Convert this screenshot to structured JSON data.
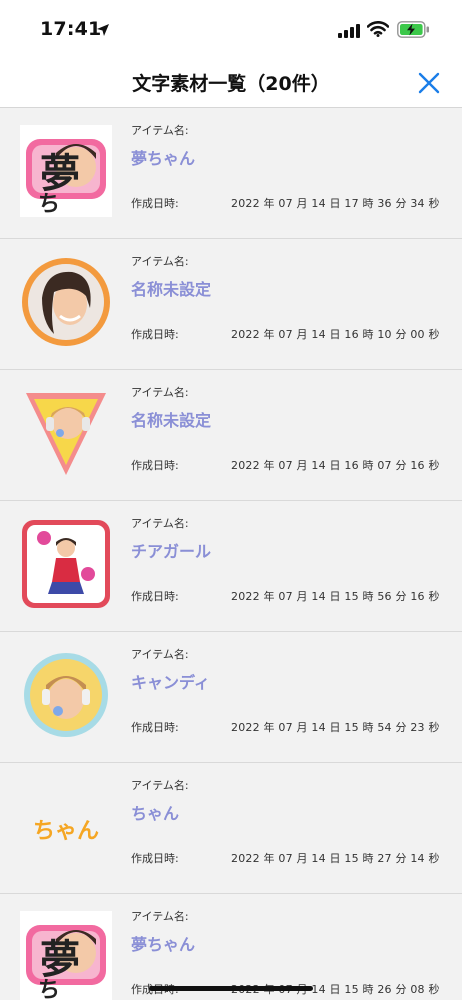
{
  "status_bar": {
    "time": "17:41"
  },
  "header": {
    "title": "文字素材一覧（20件）",
    "close_icon": "close-icon",
    "accent_color": "#1a7de8"
  },
  "labels": {
    "item_name": "アイテム名:",
    "created_at": "作成日時:"
  },
  "items": [
    {
      "name": "夢ちゃん",
      "date": "2022 年 07 月 14 日  17 時 36 分 34 秒",
      "thumb": "yume-chan-pink-text-frame"
    },
    {
      "name": "名称未設定",
      "date": "2022 年 07 月 14 日  16 時 10 分 00 秒",
      "thumb": "orange-circle-frame"
    },
    {
      "name": "名称未設定",
      "date": "2022 年 07 月 14 日  16 時 07 分 16 秒",
      "thumb": "yellow-triangle-frame"
    },
    {
      "name": "チアガール",
      "date": "2022 年 07 月 14 日  15 時 56 分 16 秒",
      "thumb": "red-square-frame"
    },
    {
      "name": "キャンディ",
      "date": "2022 年 07 月 14 日  15 時 54 分 23 秒",
      "thumb": "light-blue-circle-frame"
    },
    {
      "name": "ちゃん",
      "date": "2022 年 07 月 14 日  15 時 27 分 14 秒",
      "thumb": "chan-orange-text",
      "thumb_text": "ちゃん"
    },
    {
      "name": "夢ちゃん",
      "date": "2022 年 07 月 14 日  15 時 26 分 08 秒",
      "thumb": "yume-chan-pink-text-frame"
    }
  ],
  "colors": {
    "item_name": "#8a8fd6",
    "background": "#f2f2f2"
  }
}
